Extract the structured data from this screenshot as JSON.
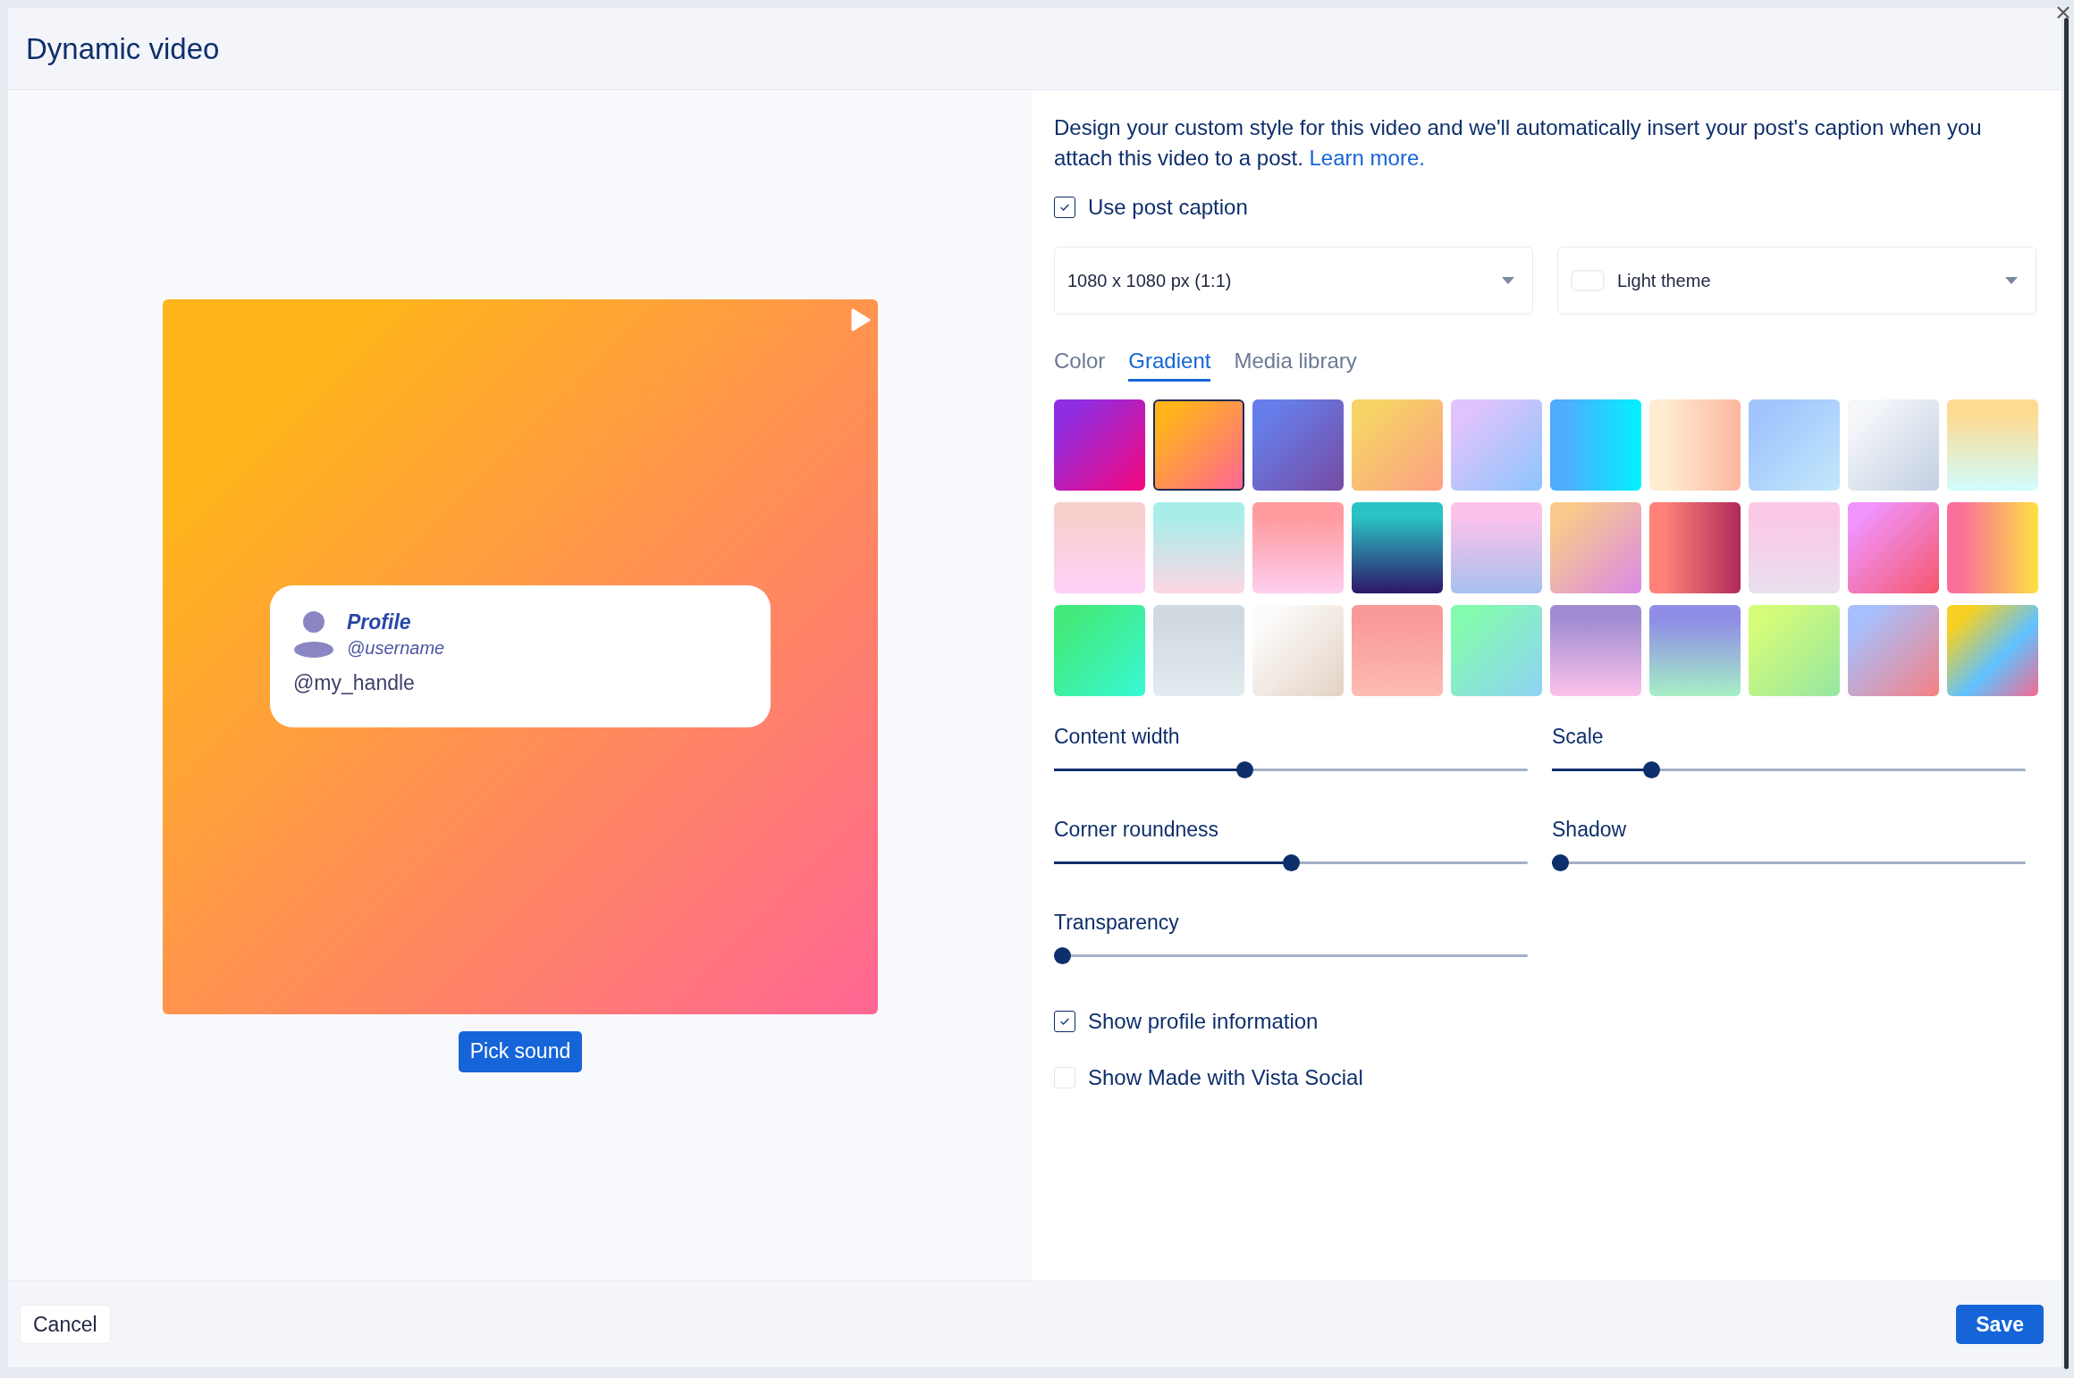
{
  "window": {
    "title": "Dynamic video"
  },
  "preview": {
    "profile_name": "Profile",
    "username": "@username",
    "handle": "@my_handle",
    "button": "Pick sound"
  },
  "settings": {
    "description": "Design your custom style for this video and we'll automatically insert your post's caption when you attach this video to a post.",
    "link": "Learn more.",
    "use_post_caption": {
      "label": "Use post caption",
      "checked": true
    },
    "size_select": {
      "value": "1080 x 1080 px (1:1)"
    },
    "theme_select": {
      "value": "Light theme"
    }
  },
  "tabs": [
    {
      "label": "Color",
      "selected": false
    },
    {
      "label": "Gradient",
      "selected": true
    },
    {
      "label": "Media library",
      "selected": false
    }
  ],
  "swatches": [
    {
      "color": "#8e2de2",
      "selected": false
    },
    {
      "color": "#ffb41c",
      "selected": true
    },
    {
      "color": "#667eea",
      "selected": false
    },
    {
      "color": "#f6d365",
      "selected": false
    },
    {
      "color": "#e0c3fc",
      "selected": false
    },
    {
      "color": "#4facfe",
      "selected": false
    },
    {
      "color": "#ffecd2",
      "selected": false
    },
    {
      "color": "#a1c4fd",
      "selected": false
    },
    {
      "color": "#f5f7fa",
      "selected": false
    },
    {
      "color": "#fddb92",
      "selected": false
    },
    {
      "color": "#f8cfcc",
      "selected": false
    },
    {
      "color": "#a8edea",
      "selected": false
    },
    {
      "color": "#ff9a9e",
      "selected": false
    },
    {
      "color": "#2ac3c5",
      "selected": false
    },
    {
      "color": "#fbc2eb",
      "selected": false
    },
    {
      "color": "#f9c98c",
      "selected": false
    },
    {
      "color": "#ff8177",
      "selected": false
    },
    {
      "color": "#fbc8e6",
      "selected": false
    },
    {
      "color": "#f093fb",
      "selected": false
    },
    {
      "color": "#fa709a",
      "selected": false
    },
    {
      "color": "#43e97b",
      "selected": false
    },
    {
      "color": "#cfd9df",
      "selected": false
    },
    {
      "color": "#fdfcfb",
      "selected": false
    },
    {
      "color": "#f99a9a",
      "selected": false
    },
    {
      "color": "#84fab0",
      "selected": false
    },
    {
      "color": "#a18cd1",
      "selected": false
    },
    {
      "color": "#8f8de6",
      "selected": false
    },
    {
      "color": "#d4fc79",
      "selected": false
    },
    {
      "color": "#a6c0fe",
      "selected": false
    },
    {
      "color": "#f6d023",
      "selected": false
    }
  ],
  "sliders": [
    {
      "label": "Content width",
      "level": 0.4
    },
    {
      "label": "Scale",
      "level": 0.2
    },
    {
      "label": "Corner roundness",
      "level": 0.5
    },
    {
      "label": "Shadow",
      "level": 0
    },
    {
      "label": "Transparency",
      "level": 0
    }
  ],
  "options": [
    {
      "label": "Show profile information",
      "checked": true
    },
    {
      "label": "Show Made with Vista Social",
      "checked": false
    }
  ],
  "footer": {
    "cancel": "Cancel",
    "save": "Save"
  }
}
